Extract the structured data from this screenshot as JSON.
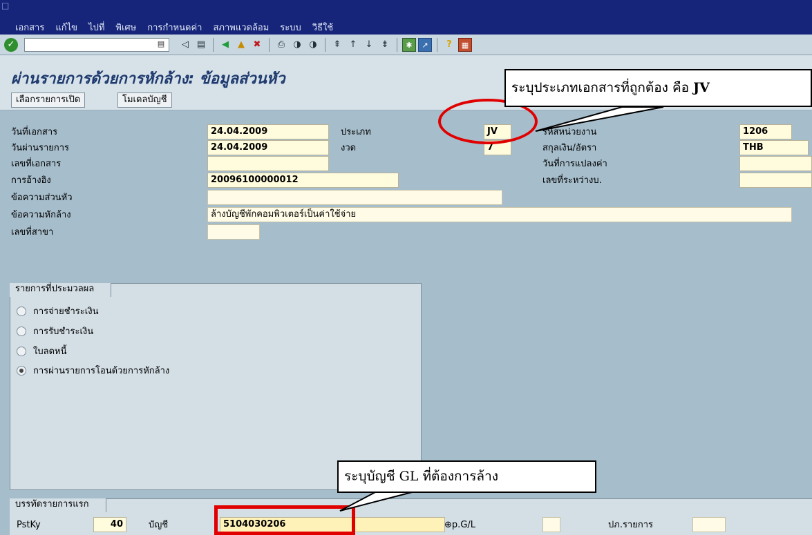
{
  "menu": [
    "เอกสาร",
    "แก้ไข",
    "ไปที่",
    "พิเศษ",
    "การกำหนดค่า",
    "สภาพแวดล้อม",
    "ระบบ",
    "วิธีใช้"
  ],
  "page_title": "ผ่านรายการด้วยการหักล้าง: ข้อมูลส่วนหัว",
  "app_buttons": [
    "เลือกรายการเปิด",
    "โมเดลบัญชี"
  ],
  "header": {
    "doc_date_label": "วันที่เอกสาร",
    "doc_date": "24.04.2009",
    "posting_date_label": "วันผ่านรายการ",
    "posting_date": "24.04.2009",
    "doc_no_label": "เลขที่เอกสาร",
    "doc_no": "",
    "reference_label": "การอ้างอิง",
    "reference": "20096100000012",
    "header_text_label": "ข้อความส่วนหัว",
    "header_text": "",
    "clearing_text_label": "ข้อความหักล้าง",
    "clearing_text": "ล้างบัญชีพักคอมพิวเตอร์เป็นค่าใช้จ่าย",
    "branch_no_label": "เลขที่สาขา",
    "branch_no": "",
    "type_label": "ประเภท",
    "type": "JV",
    "period_label": "งวด",
    "period": "7",
    "company_code_label": "รหัสหน่วยงาน",
    "company_code": "1206",
    "currency_label": "สกุลเงิน/อัตรา",
    "currency": "THB",
    "translation_date_label": "วันที่การแปลงค่า",
    "translation_date": "",
    "intercompany_label": "เลขที่ระหว่างบ.",
    "intercompany": ""
  },
  "transactions": {
    "title": "รายการที่ประมวลผล",
    "options": [
      "การจ่ายชำระเงิน",
      "การรับชำระเงิน",
      "ใบลดหนี้",
      "การผ่านรายการโอนด้วยการหักล้าง"
    ],
    "selected_index": 3
  },
  "first_line": {
    "title": "บรรทัดรายการแรก",
    "pstky_label": "PstKy",
    "pstky": "40",
    "account_label": "บัญชี",
    "account": "5104030206",
    "gl_label": "p.G/L",
    "item_type_label": "ปภ.รายการ"
  },
  "callouts": {
    "type_note": "ระบุประเภทเอกสารที่ถูกต้อง คือ",
    "type_note_bold": "JV",
    "account_note": "ระบุบัญชี GL ที่ต้องการล้าง"
  },
  "colors": {
    "menu_bg": "#16257a",
    "screen_bg": "#a6bdcb",
    "field_bg": "#fffbdd",
    "highlight": "#e00000"
  }
}
